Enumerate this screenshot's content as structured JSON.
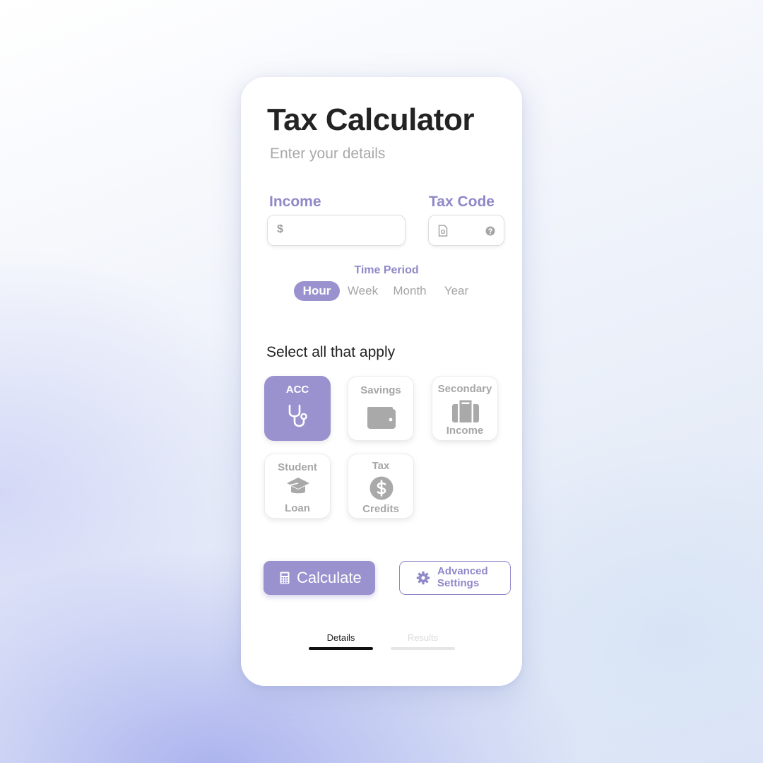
{
  "app": {
    "title": "Tax Calculator",
    "subtitle": "Enter your details"
  },
  "income": {
    "label": "Income",
    "currency_symbol": "$",
    "value": ""
  },
  "tax_code": {
    "label": "Tax Code",
    "value": "",
    "icons": [
      "document-icon",
      "help-icon"
    ]
  },
  "time_period": {
    "label": "Time Period",
    "options": [
      "Hour",
      "Week",
      "Month",
      "Year"
    ],
    "selected": "Hour"
  },
  "options_section": {
    "heading": "Select all that apply",
    "items": [
      {
        "label": "ACC",
        "icon": "stethoscope-icon",
        "selected": true
      },
      {
        "label": "Savings",
        "icon": "wallet-icon",
        "selected": false
      },
      {
        "label_top": "Secondary",
        "label_bottom": "Income",
        "icon": "briefcase-icon",
        "selected": false
      },
      {
        "label_top": "Student",
        "label_bottom": "Loan",
        "icon": "graduation-cap-icon",
        "selected": false
      },
      {
        "label_top": "Tax",
        "label_bottom": "Credits",
        "icon": "dollar-coin-icon",
        "selected": false
      }
    ]
  },
  "actions": {
    "calculate_label": "Calculate",
    "calculate_icon": "calculator-icon",
    "advanced_label_line1": "Advanced",
    "advanced_label_line2": "Settings",
    "advanced_icon": "gear-icon"
  },
  "tabs": [
    {
      "label": "Details",
      "active": true
    },
    {
      "label": "Results",
      "active": false
    }
  ],
  "colors": {
    "accent": "#9992cf",
    "accent_text": "#8f88c9",
    "title_text": "#232323",
    "muted_text": "#a9a9a9"
  }
}
